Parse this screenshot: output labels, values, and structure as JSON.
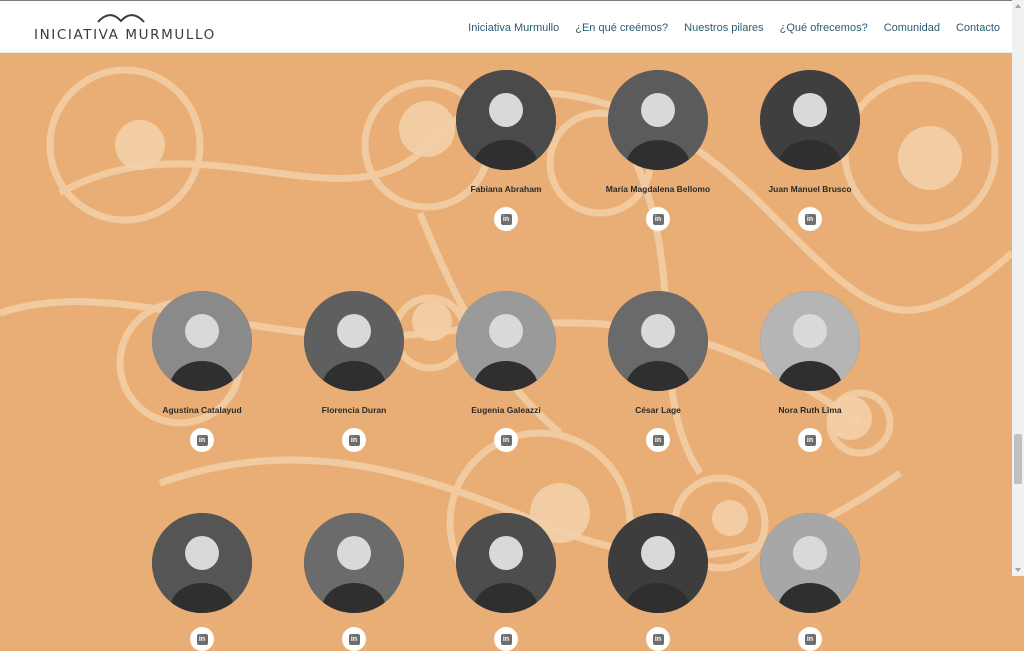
{
  "header": {
    "logo_text": "INICIATIVA MURMULLO",
    "nav": [
      "Iniciativa Murmullo",
      "¿En qué creémos?",
      "Nuestros pilares",
      "¿Qué ofrecemos?",
      "Comunidad",
      "Contacto"
    ]
  },
  "team": [
    {
      "name": "Fabiana Abraham",
      "shade": "#4a4a4a"
    },
    {
      "name": "María Magdalena Bellomo",
      "shade": "#5b5b5b"
    },
    {
      "name": "Juan Manuel Brusco",
      "shade": "#3f3f3f"
    },
    {
      "name": "Agustina Catalayud",
      "shade": "#8a8a8a"
    },
    {
      "name": "Florencia Duran",
      "shade": "#5f5f5f"
    },
    {
      "name": "Eugenia Galeazzi",
      "shade": "#9a9a9a"
    },
    {
      "name": "César Lage",
      "shade": "#6a6a6a"
    },
    {
      "name": "Nora Ruth Lima",
      "shade": "#b5b5b5"
    },
    {
      "name": "",
      "shade": "#555555"
    },
    {
      "name": "",
      "shade": "#6b6b6b"
    },
    {
      "name": "",
      "shade": "#4d4d4d"
    },
    {
      "name": "",
      "shade": "#3d3d3d"
    },
    {
      "name": "",
      "shade": "#a7a7a7"
    }
  ],
  "linkedin_label": "in",
  "colors": {
    "background": "#e9ae75",
    "nav_link": "#2d5a73",
    "decoration": "#f3cfa8"
  }
}
